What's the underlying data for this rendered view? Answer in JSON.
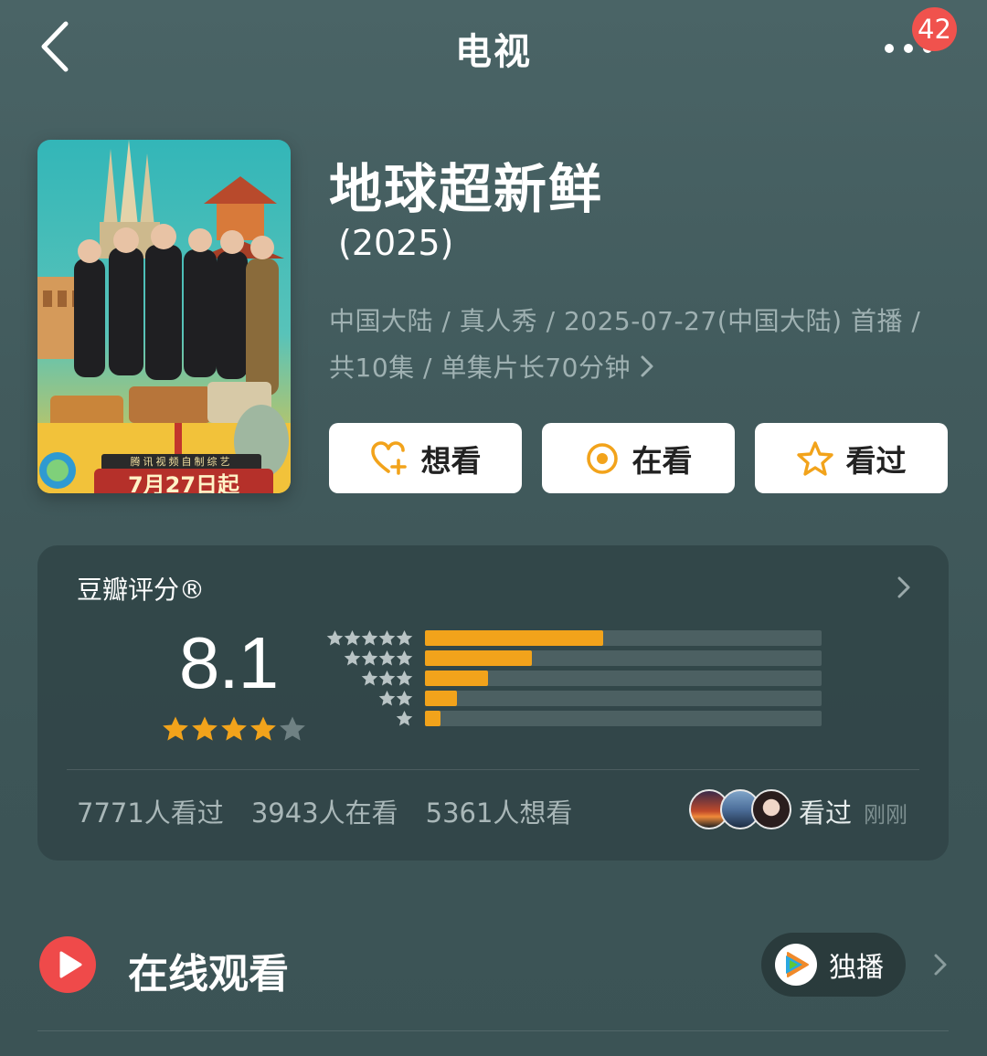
{
  "nav": {
    "title": "电视",
    "badge_count": "42",
    "back_icon": "chevron-left-icon",
    "more_icon": "more-dots-icon"
  },
  "poster": {
    "tag_text": "腾讯视频自制综艺",
    "date_text": "7月27日起"
  },
  "show": {
    "title": "地球超新鲜",
    "year": "(2025)",
    "meta_line1": "中国大陆 / 真人秀 / 2025-07-27(中国大陆) 首播 /",
    "meta_line2": "共10集 / 单集片长70分钟"
  },
  "actions": {
    "want_label": "想看",
    "watching_label": "在看",
    "watched_label": "看过",
    "accent_color": "#f2a31b"
  },
  "rating": {
    "label": "豆瓣评分®",
    "score": "8.1",
    "stars_filled": 4,
    "stars_total": 5,
    "distribution": [
      {
        "stars": 5,
        "fraction": 0.45
      },
      {
        "stars": 4,
        "fraction": 0.27
      },
      {
        "stars": 3,
        "fraction": 0.16
      },
      {
        "stars": 2,
        "fraction": 0.08
      },
      {
        "stars": 1,
        "fraction": 0.04
      }
    ],
    "stats": {
      "watched": "7771人看过",
      "watching": "3943人在看",
      "want": "5361人想看"
    },
    "friends_label": "看过",
    "friends_time": "刚刚"
  },
  "online": {
    "label": "在线观看",
    "platform_label": "独播",
    "platform_icon": "tencent-video-icon",
    "play_color": "#ef4a4a"
  }
}
